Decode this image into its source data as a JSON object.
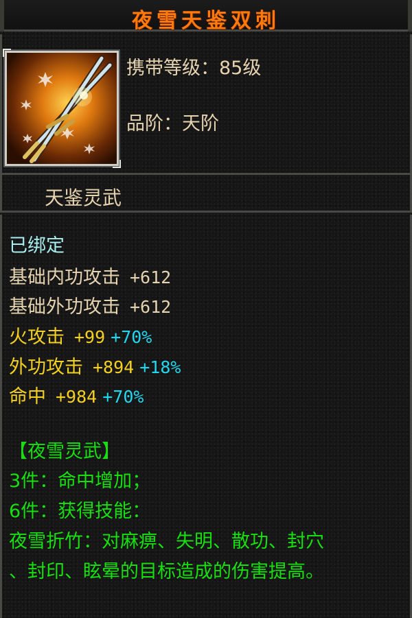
{
  "item": {
    "name": "夜雪天鉴双刺",
    "level_label": "携带等级：",
    "level_value": "85级",
    "grade_label": "品阶：",
    "grade_value": "天阶",
    "series_name": "天鉴灵武",
    "icon": "twin-daggers-icon"
  },
  "stats": {
    "bound": "已绑定",
    "base": [
      {
        "name": "基础内功攻击",
        "value": "+612"
      },
      {
        "name": "基础外功攻击",
        "value": "+612"
      }
    ],
    "bonus": [
      {
        "name": "火攻击",
        "value": "+99",
        "percent": "+70%"
      },
      {
        "name": "外功攻击",
        "value": "+894",
        "percent": "+18%"
      },
      {
        "name": "命中",
        "value": "+984",
        "percent": "+70%"
      }
    ]
  },
  "set": {
    "title": "【夜雪灵武】",
    "bonus3": "3件：命中增加；",
    "bonus6": "6件：获得技能：",
    "skill_line1": "夜雪折竹：对麻痹、失明、散功、封穴",
    "skill_line2": "、封印、眩晕的目标造成的伤害提高。"
  },
  "colors": {
    "title": "#ff7a0a",
    "base_text": "#e6d3b0",
    "bound": "#a8eef0",
    "bonus_name": "#f4d020",
    "bonus_percent": "#22d8f0",
    "set_text": "#18e010"
  }
}
